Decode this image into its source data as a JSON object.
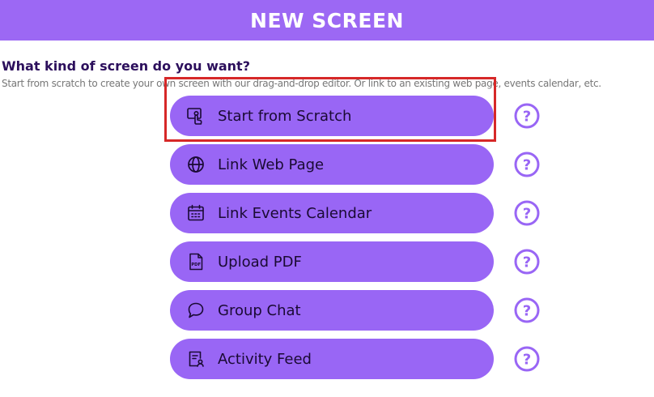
{
  "header": {
    "title": "NEW SCREEN"
  },
  "intro": {
    "question": "What kind of screen do you want?",
    "description": "Start from scratch to create your own screen with our drag-and-drop editor. Or link to an existing web page, events calendar, etc."
  },
  "options": [
    {
      "label": "Start from Scratch",
      "icon": "touch-screen-icon",
      "selected": true
    },
    {
      "label": "Link Web Page",
      "icon": "globe-icon"
    },
    {
      "label": "Link Events Calendar",
      "icon": "calendar-icon"
    },
    {
      "label": "Upload PDF",
      "icon": "pdf-file-icon"
    },
    {
      "label": "Group Chat",
      "icon": "chat-bubble-icon"
    },
    {
      "label": "Activity Feed",
      "icon": "activity-feed-icon"
    }
  ],
  "help_icon": "help-circle-icon",
  "colors": {
    "header_bg": "#9c68f4",
    "option_bg": "#9966f5",
    "help_icon": "#9966f5",
    "question_text": "#2c0f5c",
    "selection_border": "#d62828"
  }
}
